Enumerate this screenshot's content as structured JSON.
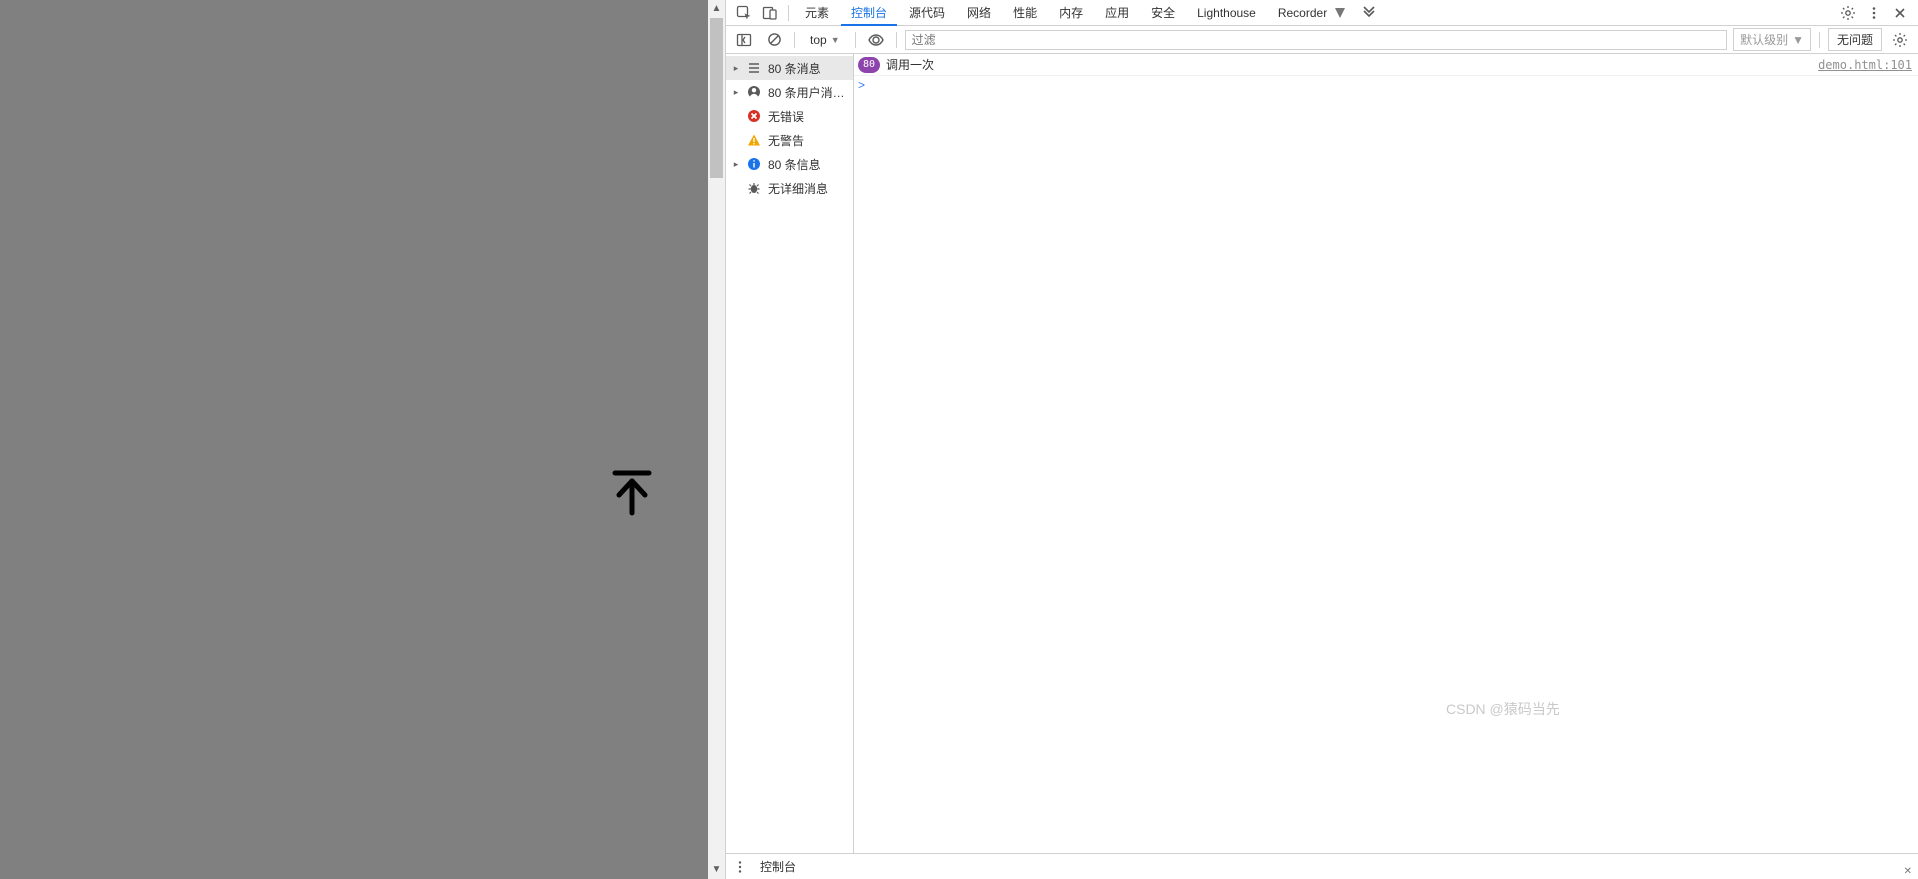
{
  "tabs": {
    "items": [
      "元素",
      "控制台",
      "源代码",
      "网络",
      "性能",
      "内存",
      "应用",
      "安全",
      "Lighthouse",
      "Recorder"
    ],
    "active_index": 1
  },
  "toolbar": {
    "context": "top",
    "filter_placeholder": "过滤",
    "levels_label": "默认级别",
    "issues_label": "无问题"
  },
  "sidebar": {
    "items": [
      {
        "icon": "list",
        "label": "80 条消息",
        "expandable": true,
        "selected": true
      },
      {
        "icon": "user",
        "label": "80 条用户消…",
        "expandable": true,
        "selected": false
      },
      {
        "icon": "error",
        "label": "无错误",
        "expandable": false,
        "selected": false
      },
      {
        "icon": "warning",
        "label": "无警告",
        "expandable": false,
        "selected": false
      },
      {
        "icon": "info",
        "label": "80 条信息",
        "expandable": true,
        "selected": false
      },
      {
        "icon": "bug",
        "label": "无详细消息",
        "expandable": false,
        "selected": false
      }
    ]
  },
  "log": {
    "count": "80",
    "message": "调用一次",
    "source": "demo.html:101"
  },
  "prompt": ">",
  "drawer": {
    "title": "控制台"
  },
  "watermark": "CSDN @猿码当先"
}
